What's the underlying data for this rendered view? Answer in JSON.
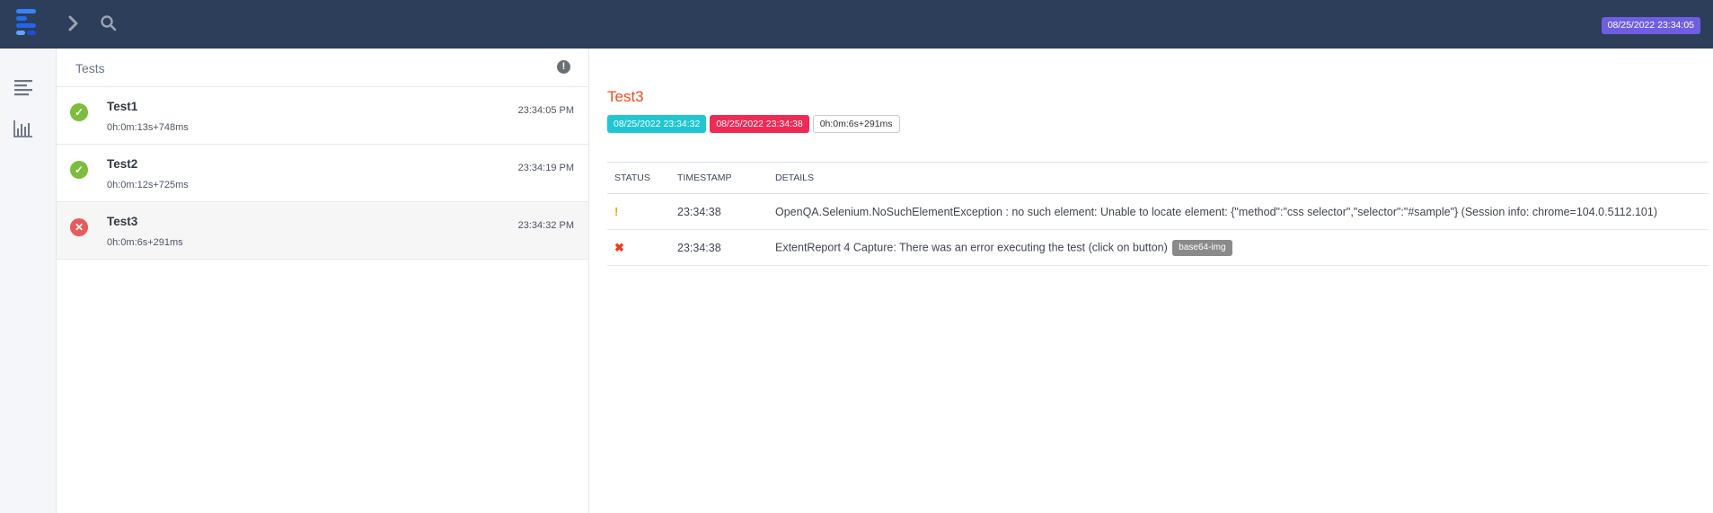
{
  "topbar": {
    "logo": "extent-logo",
    "nav_icons": [
      "chevron-right-icon",
      "search-icon"
    ],
    "date": "08/25/2022 23:34:05",
    "colors": {
      "background": "#2c3e5a",
      "date_badge": "#6f5fe0"
    }
  },
  "rail": {
    "items": [
      {
        "icon": "list-view-icon"
      },
      {
        "icon": "bar-chart-icon"
      }
    ]
  },
  "tests_panel": {
    "title": "Tests",
    "info_icon": "info-icon",
    "tests": [
      {
        "name": "Test1",
        "duration": "0h:0m:13s+748ms",
        "time": "23:34:05 PM",
        "status": "pass"
      },
      {
        "name": "Test2",
        "duration": "0h:0m:12s+725ms",
        "time": "23:34:19 PM",
        "status": "pass"
      },
      {
        "name": "Test3",
        "duration": "0h:0m:6s+291ms",
        "time": "23:34:32 PM",
        "status": "fail"
      }
    ]
  },
  "detail": {
    "title": "Test3",
    "start": "08/25/2022 23:34:32",
    "end": "08/25/2022 23:34:38",
    "duration": "0h:0m:6s+291ms",
    "columns": {
      "status": "STATUS",
      "timestamp": "TIMESTAMP",
      "details": "DETAILS"
    },
    "logs": [
      {
        "status": "warning",
        "status_glyph": "!",
        "timestamp": "23:34:38",
        "details": "OpenQA.Selenium.NoSuchElementException : no such element: Unable to locate element: {\"method\":\"css selector\",\"selector\":\"#sample\"} (Session info: chrome=104.0.5112.101)",
        "tag": ""
      },
      {
        "status": "fail",
        "status_glyph": "✖",
        "timestamp": "23:34:38",
        "details": "ExtentReport 4 Capture: There was an error executing the test (click on button)",
        "tag": "base64-img"
      }
    ],
    "colors": {
      "title": "#ec4d1e",
      "start_badge": "#21c6d3",
      "end_badge": "#ef2a55"
    }
  }
}
